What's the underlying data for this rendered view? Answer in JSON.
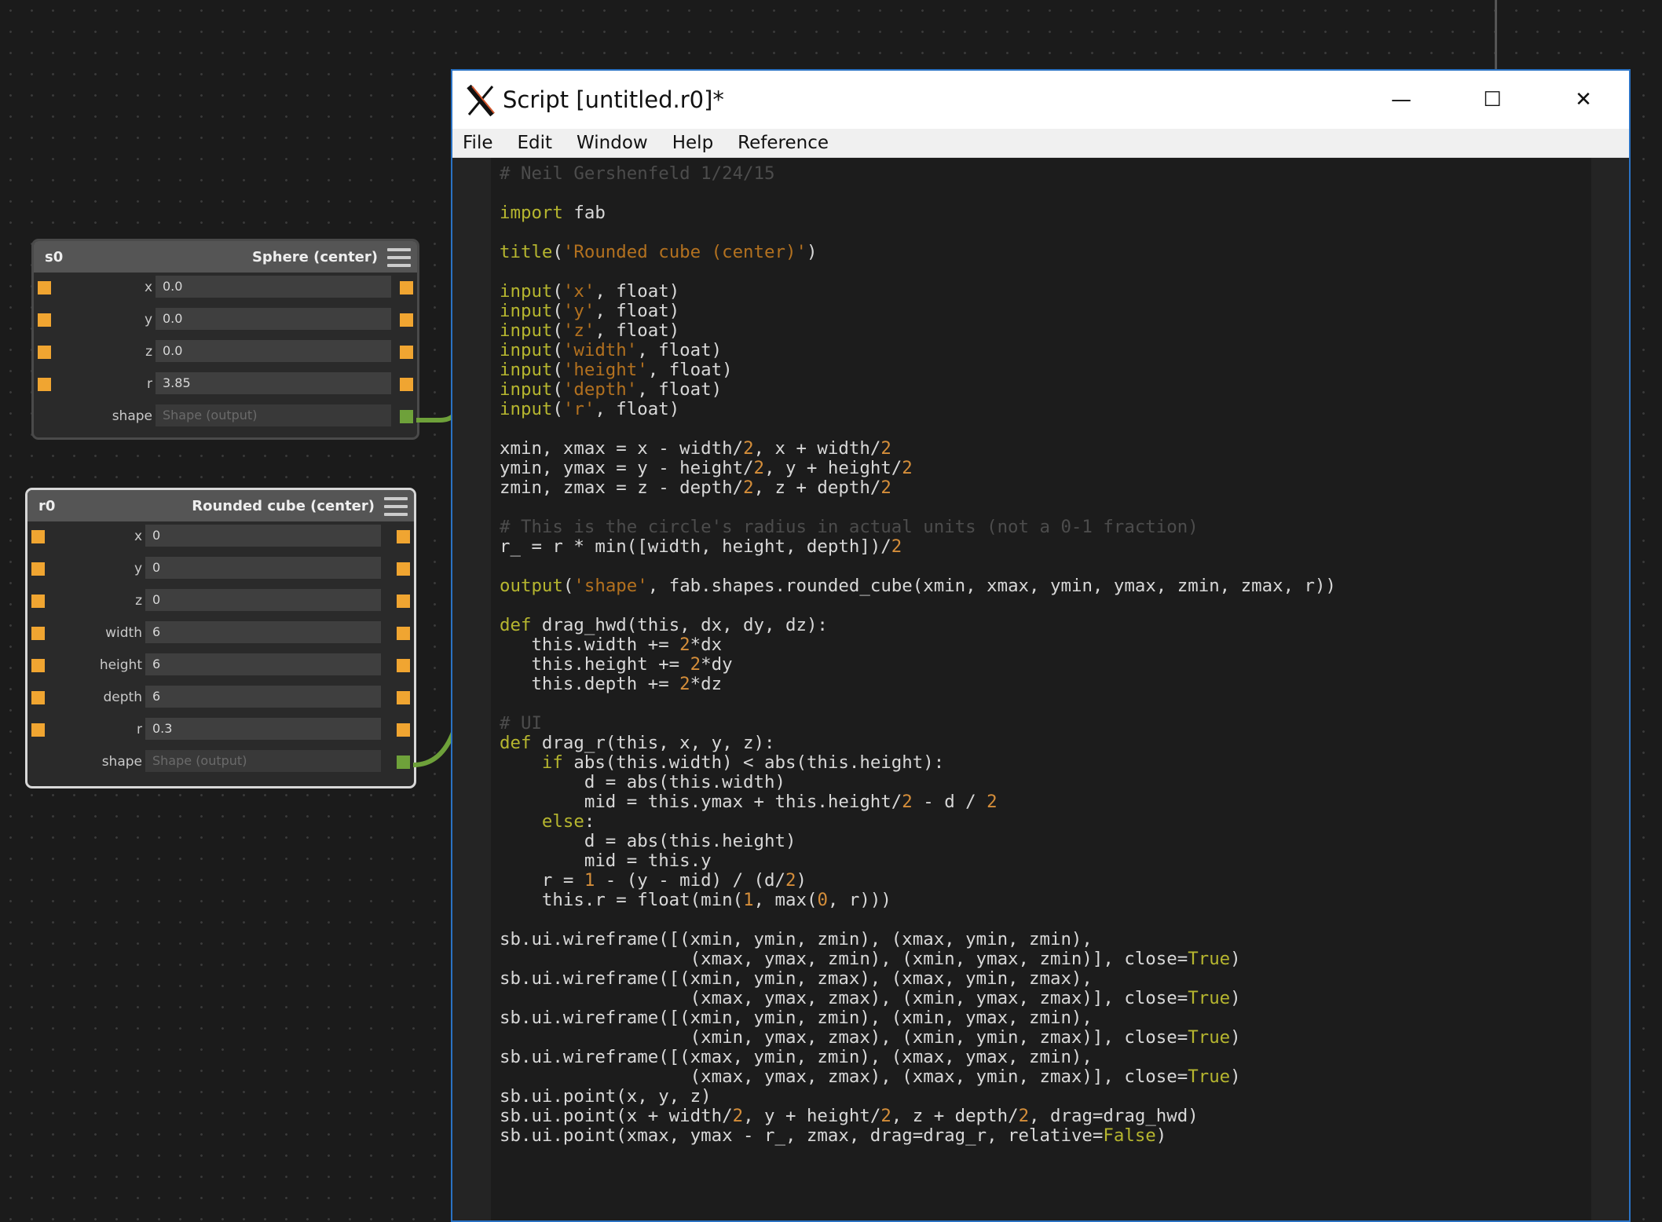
{
  "nodes": {
    "s0": {
      "name": "s0",
      "title": "Sphere (center)",
      "inputs": [
        {
          "label": "x",
          "value": "0.0"
        },
        {
          "label": "y",
          "value": "0.0"
        },
        {
          "label": "z",
          "value": "0.0"
        },
        {
          "label": "r",
          "value": "3.85"
        }
      ],
      "output": {
        "label": "shape",
        "placeholder": "Shape (output)"
      }
    },
    "r0": {
      "name": "r0",
      "title": "Rounded cube (center)",
      "inputs": [
        {
          "label": "x",
          "value": "0"
        },
        {
          "label": "y",
          "value": "0"
        },
        {
          "label": "z",
          "value": "0"
        },
        {
          "label": "width",
          "value": "6"
        },
        {
          "label": "height",
          "value": "6"
        },
        {
          "label": "depth",
          "value": "6"
        },
        {
          "label": "r",
          "value": "0.3"
        }
      ],
      "output": {
        "label": "shape",
        "placeholder": "Shape (output)"
      }
    }
  },
  "window": {
    "title": "Script [untitled.r0]*",
    "menu": [
      "File",
      "Edit",
      "Window",
      "Help",
      "Reference"
    ],
    "controls": {
      "minimize": "—",
      "maximize": "☐",
      "close": "✕"
    }
  },
  "colors": {
    "canvas": "#1b1b1b",
    "port_input": "#f0a531",
    "port_shape": "#6ea13a",
    "window_border": "#2a72c4",
    "code_keyword": "#b6b62f",
    "code_string": "#b3711f",
    "code_comment": "#4c4c4c"
  },
  "icons": {
    "app": "fab-x-icon",
    "node_menu": "hamburger-icon"
  },
  "code": [
    [
      [
        "c",
        "# Neil Gershenfeld 1/24/15"
      ]
    ],
    [],
    [
      [
        "k",
        "import"
      ],
      [
        "p",
        " fab"
      ]
    ],
    [],
    [
      [
        "k",
        "title"
      ],
      [
        "p",
        "("
      ],
      [
        "s",
        "'Rounded cube (center)'"
      ],
      [
        "p",
        ")"
      ]
    ],
    [],
    [
      [
        "k",
        "input"
      ],
      [
        "p",
        "("
      ],
      [
        "s",
        "'x'"
      ],
      [
        "p",
        ", float)"
      ]
    ],
    [
      [
        "k",
        "input"
      ],
      [
        "p",
        "("
      ],
      [
        "s",
        "'y'"
      ],
      [
        "p",
        ", float)"
      ]
    ],
    [
      [
        "k",
        "input"
      ],
      [
        "p",
        "("
      ],
      [
        "s",
        "'z'"
      ],
      [
        "p",
        ", float)"
      ]
    ],
    [
      [
        "k",
        "input"
      ],
      [
        "p",
        "("
      ],
      [
        "s",
        "'width'"
      ],
      [
        "p",
        ", float)"
      ]
    ],
    [
      [
        "k",
        "input"
      ],
      [
        "p",
        "("
      ],
      [
        "s",
        "'height'"
      ],
      [
        "p",
        ", float)"
      ]
    ],
    [
      [
        "k",
        "input"
      ],
      [
        "p",
        "("
      ],
      [
        "s",
        "'depth'"
      ],
      [
        "p",
        ", float)"
      ]
    ],
    [
      [
        "k",
        "input"
      ],
      [
        "p",
        "("
      ],
      [
        "s",
        "'r'"
      ],
      [
        "p",
        ", float)"
      ]
    ],
    [],
    [
      [
        "p",
        "xmin, xmax = x - width/"
      ],
      [
        "n",
        "2"
      ],
      [
        "p",
        ", x + width/"
      ],
      [
        "n",
        "2"
      ]
    ],
    [
      [
        "p",
        "ymin, ymax = y - height/"
      ],
      [
        "n",
        "2"
      ],
      [
        "p",
        ", y + height/"
      ],
      [
        "n",
        "2"
      ]
    ],
    [
      [
        "p",
        "zmin, zmax = z - depth/"
      ],
      [
        "n",
        "2"
      ],
      [
        "p",
        ", z + depth/"
      ],
      [
        "n",
        "2"
      ]
    ],
    [],
    [
      [
        "c",
        "# This is the circle's radius in actual units (not a 0-1 fraction)"
      ]
    ],
    [
      [
        "p",
        "r_ = r * min([width, height, depth])/"
      ],
      [
        "n",
        "2"
      ]
    ],
    [],
    [
      [
        "k",
        "output"
      ],
      [
        "p",
        "("
      ],
      [
        "s",
        "'shape'"
      ],
      [
        "p",
        ", fab.shapes.rounded_cube(xmin, xmax, ymin, ymax, zmin, zmax, r))"
      ]
    ],
    [],
    [
      [
        "k",
        "def"
      ],
      [
        "p",
        " drag_hwd(this, dx, dy, dz):"
      ]
    ],
    [
      [
        "p",
        "   this.width += "
      ],
      [
        "n",
        "2"
      ],
      [
        "p",
        "*dx"
      ]
    ],
    [
      [
        "p",
        "   this.height += "
      ],
      [
        "n",
        "2"
      ],
      [
        "p",
        "*dy"
      ]
    ],
    [
      [
        "p",
        "   this.depth += "
      ],
      [
        "n",
        "2"
      ],
      [
        "p",
        "*dz"
      ]
    ],
    [],
    [
      [
        "c",
        "# UI"
      ]
    ],
    [
      [
        "k",
        "def"
      ],
      [
        "p",
        " drag_r(this, x, y, z):"
      ]
    ],
    [
      [
        "p",
        "    "
      ],
      [
        "k",
        "if"
      ],
      [
        "p",
        " abs(this.width) < abs(this.height):"
      ]
    ],
    [
      [
        "p",
        "        d = abs(this.width)"
      ]
    ],
    [
      [
        "p",
        "        mid = this.ymax + this.height/"
      ],
      [
        "n",
        "2"
      ],
      [
        "p",
        " - d / "
      ],
      [
        "n",
        "2"
      ]
    ],
    [
      [
        "p",
        "    "
      ],
      [
        "k",
        "else"
      ],
      [
        "p",
        ":"
      ]
    ],
    [
      [
        "p",
        "        d = abs(this.height)"
      ]
    ],
    [
      [
        "p",
        "        mid = this.y"
      ]
    ],
    [
      [
        "p",
        "    r = "
      ],
      [
        "n",
        "1"
      ],
      [
        "p",
        " - (y - mid) / (d/"
      ],
      [
        "n",
        "2"
      ],
      [
        "p",
        ")"
      ]
    ],
    [
      [
        "p",
        "    this.r = float(min("
      ],
      [
        "n",
        "1"
      ],
      [
        "p",
        ", max("
      ],
      [
        "n",
        "0"
      ],
      [
        "p",
        ", r)))"
      ]
    ],
    [],
    [
      [
        "p",
        "sb.ui.wireframe([(xmin, ymin, zmin), (xmax, ymin, zmin),"
      ]
    ],
    [
      [
        "p",
        "                  (xmax, ymax, zmin), (xmin, ymax, zmin)], close="
      ],
      [
        "k",
        "True"
      ],
      [
        "p",
        ")"
      ]
    ],
    [
      [
        "p",
        "sb.ui.wireframe([(xmin, ymin, zmax), (xmax, ymin, zmax),"
      ]
    ],
    [
      [
        "p",
        "                  (xmax, ymax, zmax), (xmin, ymax, zmax)], close="
      ],
      [
        "k",
        "True"
      ],
      [
        "p",
        ")"
      ]
    ],
    [
      [
        "p",
        "sb.ui.wireframe([(xmin, ymin, zmin), (xmin, ymax, zmin),"
      ]
    ],
    [
      [
        "p",
        "                  (xmin, ymax, zmax), (xmin, ymin, zmax)], close="
      ],
      [
        "k",
        "True"
      ],
      [
        "p",
        ")"
      ]
    ],
    [
      [
        "p",
        "sb.ui.wireframe([(xmax, ymin, zmin), (xmax, ymax, zmin),"
      ]
    ],
    [
      [
        "p",
        "                  (xmax, ymax, zmax), (xmax, ymin, zmax)], close="
      ],
      [
        "k",
        "True"
      ],
      [
        "p",
        ")"
      ]
    ],
    [
      [
        "p",
        "sb.ui.point(x, y, z)"
      ]
    ],
    [
      [
        "p",
        "sb.ui.point(x + width/"
      ],
      [
        "n",
        "2"
      ],
      [
        "p",
        ", y + height/"
      ],
      [
        "n",
        "2"
      ],
      [
        "p",
        ", z + depth/"
      ],
      [
        "n",
        "2"
      ],
      [
        "p",
        ", drag=drag_hwd)"
      ]
    ],
    [
      [
        "p",
        "sb.ui.point(xmax, ymax - r_, zmax, drag=drag_r, relative="
      ],
      [
        "k",
        "False"
      ],
      [
        "p",
        ")"
      ]
    ]
  ]
}
